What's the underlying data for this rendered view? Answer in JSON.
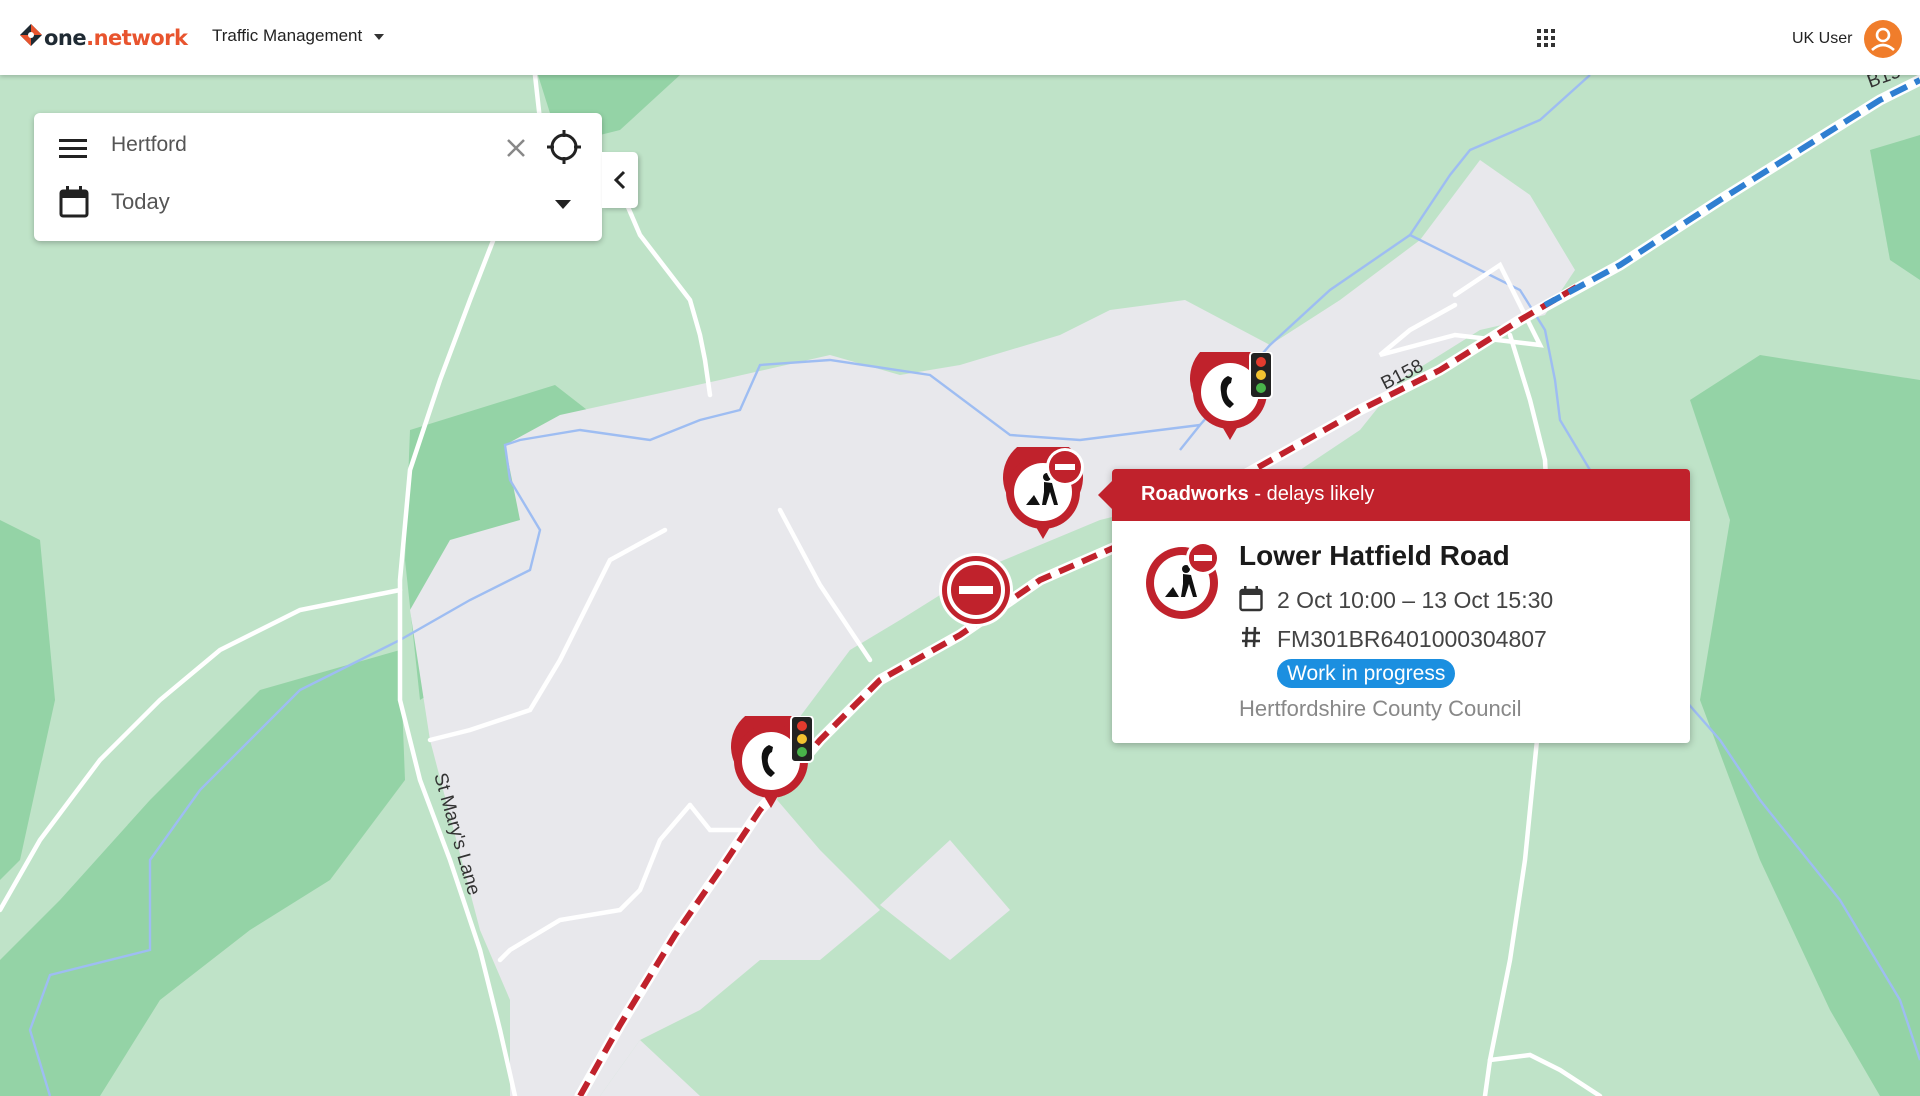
{
  "header": {
    "logo_one": "one",
    "logo_network": ".network",
    "app_menu_label": "Traffic Management",
    "user_label": "UK User"
  },
  "search_panel": {
    "location_value": "Hertford",
    "date_value": "Today"
  },
  "map": {
    "road_labels": [
      "B158",
      "St Mary's Lane",
      "B15"
    ],
    "colors": {
      "land": "#bfe3c8",
      "woodland": "#94d3a6",
      "urban": "#e8e8ec",
      "water": "#9ebdf2",
      "restriction_red": "#c0222c",
      "diversion_blue": "#2f7fd1"
    }
  },
  "popup": {
    "category": "Roadworks",
    "impact": " - delays likely",
    "title": "Lower Hatfield Road",
    "dates": "2 Oct 10:00 – 13 Oct 15:30",
    "reference": "FM301BR6401000304807",
    "status": "Work in progress",
    "organisation": "Hertfordshire County Council",
    "status_color": "#1b8fe0"
  },
  "markers": [
    {
      "type": "traffic-signals-icon"
    },
    {
      "type": "roadworks-icon"
    },
    {
      "type": "road-closure-icon"
    },
    {
      "type": "traffic-signals-icon"
    }
  ]
}
